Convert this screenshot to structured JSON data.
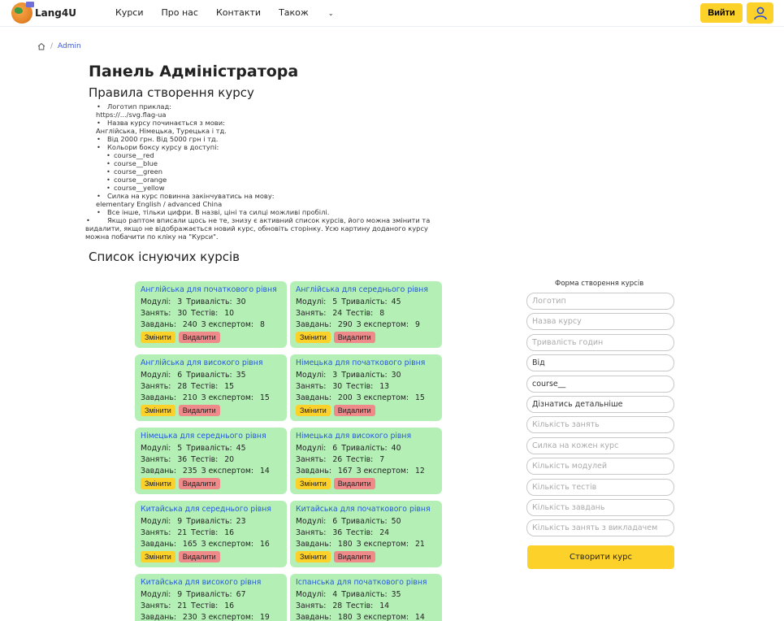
{
  "nav": {
    "brand": "Lang4U",
    "links": [
      "Курси",
      "Про нас",
      "Контакти"
    ],
    "more_label": "Також",
    "login_label": "Вийти",
    "accent_color": "#fcd12a"
  },
  "breadcrumb": {
    "current": "Admin"
  },
  "page_title": "Панель Адміністратора",
  "rules_title": "Правила створення курсу",
  "rules": {
    "logo_label": "Логотип приклад:",
    "logo_example": "https://.../svg.flag-ua",
    "name_label": "Назва курсу починається з мови:",
    "name_example": "Англійська, Німецька, Турецька і тд.",
    "price": "Від 2000 грн. Від 5000 грн і тд.",
    "colors_label": "Кольори боксу курсу в доступі:",
    "colors": [
      "course__red",
      "course__blue",
      "course__green",
      "course__orange",
      "course__yellow"
    ],
    "link_label": "Силка на курс повинна закінчуватись на мову:",
    "link_example": "elementary English / advanced China",
    "digits": "Все інше, тільки цифри. В назві, ціні та силці можливі пробілі.",
    "note": "Якщо раптом вписали щось не те, знизу є активний список курсів, його можна змінити та видалити, якщо не відображається новий курс, обновіть сторінку. Усю картину доданого курсу можна побачити по кліку на \"Курси\"."
  },
  "list_title": "Список існуючих курсів",
  "card_labels": {
    "modules": "Модулі:",
    "duration": "Тривалість:",
    "lessons": "Занять:",
    "tests": "Тестів:",
    "tasks": "Завдань:",
    "expert": "З експертом:",
    "edit": "Змінити",
    "delete": "Видалити"
  },
  "courses": [
    {
      "title": "Англійська для початкового рівня",
      "modules": "3",
      "duration": "30",
      "lessons": "30",
      "tests": "10",
      "tasks": "240",
      "expert": "8"
    },
    {
      "title": "Англійська для середнього рівня",
      "modules": "5",
      "duration": "45",
      "lessons": "24",
      "tests": "8",
      "tasks": "290",
      "expert": "9"
    },
    {
      "title": "Англійська для високого рівня",
      "modules": "6",
      "duration": "35",
      "lessons": "28",
      "tests": "15",
      "tasks": "210",
      "expert": "15"
    },
    {
      "title": "Німецька для початкового рівня",
      "modules": "3",
      "duration": "30",
      "lessons": "30",
      "tests": "13",
      "tasks": "200",
      "expert": "15"
    },
    {
      "title": "Німецька для середнього рівня",
      "modules": "5",
      "duration": "45",
      "lessons": "36",
      "tests": "20",
      "tasks": "235",
      "expert": "14"
    },
    {
      "title": "Німецька для високого рівня",
      "modules": "6",
      "duration": "40",
      "lessons": "26",
      "tests": "7",
      "tasks": "167",
      "expert": "12"
    },
    {
      "title": "Китайська для середнього рівня",
      "modules": "9",
      "duration": "23",
      "lessons": "21",
      "tests": "16",
      "tasks": "165",
      "expert": "16"
    },
    {
      "title": "Китайська для початкового рівня",
      "modules": "6",
      "duration": "50",
      "lessons": "36",
      "tests": "24",
      "tasks": "180",
      "expert": "21"
    },
    {
      "title": "Китайська для високого рівня",
      "modules": "9",
      "duration": "67",
      "lessons": "21",
      "tests": "16",
      "tasks": "230",
      "expert": "19"
    },
    {
      "title": "Іспанська для початкового рівня",
      "modules": "4",
      "duration": "35",
      "lessons": "28",
      "tests": "14",
      "tasks": "180",
      "expert": "14"
    }
  ],
  "form": {
    "title": "Форма створення курсів",
    "fields": [
      {
        "placeholder": "Логотип",
        "value": ""
      },
      {
        "placeholder": "Назва курсу",
        "value": ""
      },
      {
        "placeholder": "Тривалість годин",
        "value": ""
      },
      {
        "placeholder": "",
        "value": "Від"
      },
      {
        "placeholder": "",
        "value": "course__"
      },
      {
        "placeholder": "",
        "value": "Дізнатись детальніше"
      },
      {
        "placeholder": "Кількість занять",
        "value": ""
      },
      {
        "placeholder": "Силка на кожен курс",
        "value": ""
      },
      {
        "placeholder": "Кількість модулей",
        "value": ""
      },
      {
        "placeholder": "Кількість тестів",
        "value": ""
      },
      {
        "placeholder": "Кількість завдань",
        "value": ""
      },
      {
        "placeholder": "Кількість занять з викладачем",
        "value": ""
      }
    ],
    "submit_label": "Створити курс"
  }
}
